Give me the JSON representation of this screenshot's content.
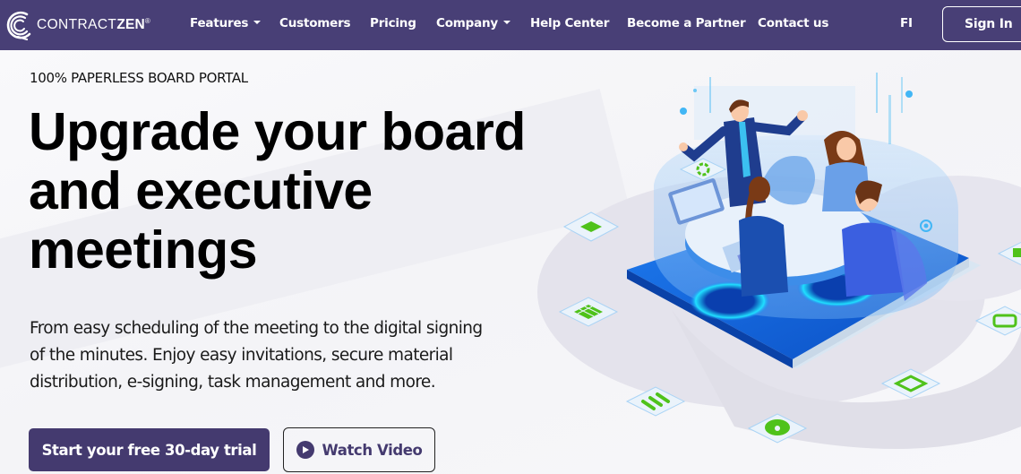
{
  "brand": {
    "name_light": "CONTRACT",
    "name_bold": "ZEN",
    "trademark": "®",
    "logo_icon": "swirl-c-logo-icon"
  },
  "nav": {
    "items": [
      {
        "label": "Features",
        "has_dropdown": true
      },
      {
        "label": "Customers",
        "has_dropdown": false
      },
      {
        "label": "Pricing",
        "has_dropdown": false
      },
      {
        "label": "Company",
        "has_dropdown": true
      },
      {
        "label": "Help Center",
        "has_dropdown": false
      },
      {
        "label": "Become a Partner",
        "has_dropdown": false
      },
      {
        "label": "Contact us",
        "has_dropdown": false
      }
    ],
    "language": "FI",
    "sign_in": "Sign In"
  },
  "hero": {
    "eyebrow": "100% PAPERLESS BOARD PORTAL",
    "headline_lines": [
      "Upgrade your board",
      "and executive",
      "meetings"
    ],
    "subtext_lines": [
      "From easy scheduling of the meeting to the digital signing",
      "of the minutes. Enjoy easy invitations, secure material",
      "distribution, e-signing, task management and more."
    ],
    "cta_primary": "Start your free 30-day trial",
    "cta_secondary": "Watch Video",
    "cta_secondary_icon": "play-circle-icon"
  },
  "illustration": {
    "description": "Isometric illustration of four people meeting around a round table on a blue platform with floating green feature icons",
    "feature_icons": [
      "refresh-icon",
      "document-edit-icon",
      "calendar-icon",
      "list-icon",
      "cloud-lock-icon",
      "notification-bell-icon",
      "mobile-icon"
    ]
  },
  "colors": {
    "nav_bg": "#483f76",
    "primary_button": "#443a6f",
    "accent_green": "#56c41a",
    "accent_blue": "#1565d8"
  }
}
